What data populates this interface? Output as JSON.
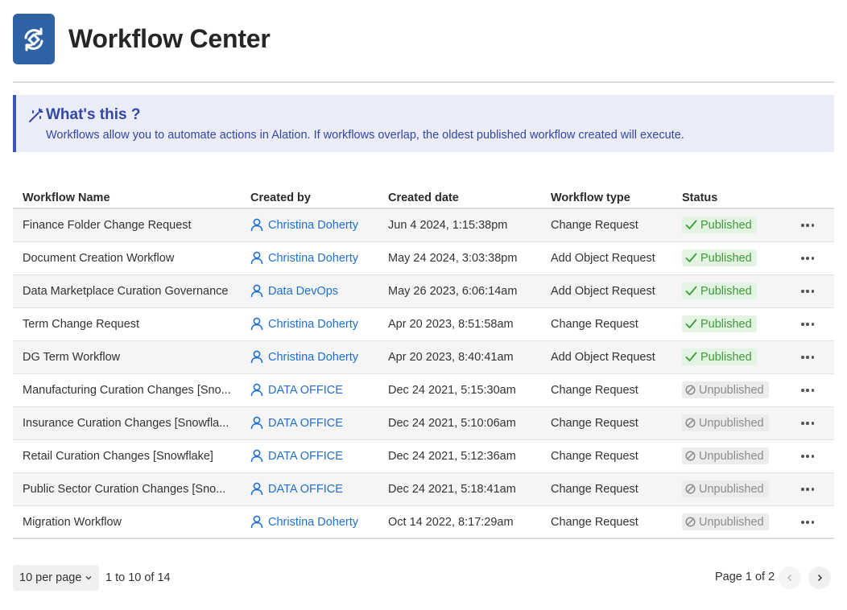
{
  "header": {
    "title": "Workflow Center",
    "logo_icon": "workflow-sync-icon"
  },
  "info": {
    "icon": "magic-wand-icon",
    "title": "What's this ?",
    "text": "Workflows allow you to automate actions in Alation. If workflows overlap, the oldest published workflow created will execute."
  },
  "table": {
    "columns": [
      "Workflow Name",
      "Created by",
      "Created date",
      "Workflow type",
      "Status"
    ],
    "rows": [
      {
        "name": "Finance Folder Change Request",
        "created_by": "Christina Doherty",
        "created_date": "Jun 4 2024, 1:15:38pm",
        "type": "Change Request",
        "status": "Published"
      },
      {
        "name": "Document Creation Workflow",
        "created_by": "Christina Doherty",
        "created_date": "May 24 2024, 3:03:38pm",
        "type": "Add Object Request",
        "status": "Published"
      },
      {
        "name": "Data Marketplace Curation Governance",
        "created_by": "Data DevOps",
        "created_date": "May 26 2023, 6:06:14am",
        "type": "Add Object Request",
        "status": "Published"
      },
      {
        "name": "Term Change Request",
        "created_by": "Christina Doherty",
        "created_date": "Apr 20 2023, 8:51:58am",
        "type": "Change Request",
        "status": "Published"
      },
      {
        "name": "DG Term Workflow",
        "created_by": "Christina Doherty",
        "created_date": "Apr 20 2023, 8:40:41am",
        "type": "Add Object Request",
        "status": "Published"
      },
      {
        "name": "Manufacturing Curation Changes [Sno...",
        "created_by": "DATA OFFICE",
        "created_date": "Dec 24 2021, 5:15:30am",
        "type": "Change Request",
        "status": "Unpublished"
      },
      {
        "name": "Insurance Curation Changes [Snowfla...",
        "created_by": "DATA OFFICE",
        "created_date": "Dec 24 2021, 5:10:06am",
        "type": "Change Request",
        "status": "Unpublished"
      },
      {
        "name": "Retail Curation Changes [Snowflake]",
        "created_by": "DATA OFFICE",
        "created_date": "Dec 24 2021, 5:12:36am",
        "type": "Change Request",
        "status": "Unpublished"
      },
      {
        "name": "Public Sector Curation Changes [Sno...",
        "created_by": "DATA OFFICE",
        "created_date": "Dec 24 2021, 5:18:41am",
        "type": "Change Request",
        "status": "Unpublished"
      },
      {
        "name": "Migration Workflow",
        "created_by": "Christina Doherty",
        "created_date": "Oct 14 2022, 8:17:29am",
        "type": "Change Request",
        "status": "Unpublished"
      }
    ]
  },
  "footer": {
    "per_page": "10 per page",
    "range": "1 to 10 of 14",
    "page_info": "Page 1 of 2"
  },
  "colors": {
    "logo": "#2e62a4",
    "info_accent": "#3b55b8",
    "link": "#1f6fd0",
    "published": "#3e9b3a",
    "unpublished": "#8c8c8c"
  }
}
